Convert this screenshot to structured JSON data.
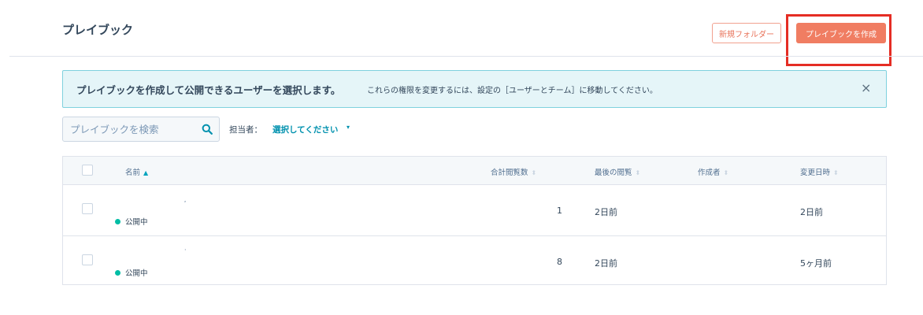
{
  "header": {
    "title": "プレイブック",
    "new_folder_label": "新規フォルダー",
    "create_label": "プレイブックを作成"
  },
  "banner": {
    "strong_text": "プレイブックを作成して公開できるユーザーを選択します。",
    "text": "これらの権限を変更するには、設定の［ユーザーとチーム］に移動してください。",
    "close_glyph": "×"
  },
  "search": {
    "placeholder": "プレイブックを検索"
  },
  "owner_filter": {
    "label": "担当者：",
    "value": "選択してください",
    "caret": "▾"
  },
  "table": {
    "columns": [
      {
        "label": "名前",
        "sort": "▲",
        "active": true
      },
      {
        "label": "合計閲覧数",
        "sort": "⬍"
      },
      {
        "label": "最後の閲覧",
        "sort": "⬍"
      },
      {
        "label": "作成者",
        "sort": "⬍"
      },
      {
        "label": "変更日時",
        "sort": "⬍"
      }
    ],
    "rows": [
      {
        "status": "公開中",
        "views": "1",
        "last_viewed": "2日前",
        "author": "",
        "modified": "2日前"
      },
      {
        "status": "公開中",
        "views": "8",
        "last_viewed": "2日前",
        "author": "",
        "modified": "5ヶ月前"
      }
    ]
  },
  "colors": {
    "accent": "#f07d62",
    "highlight": "#e52d24",
    "link": "#0091ae",
    "published_dot": "#00bda5"
  }
}
